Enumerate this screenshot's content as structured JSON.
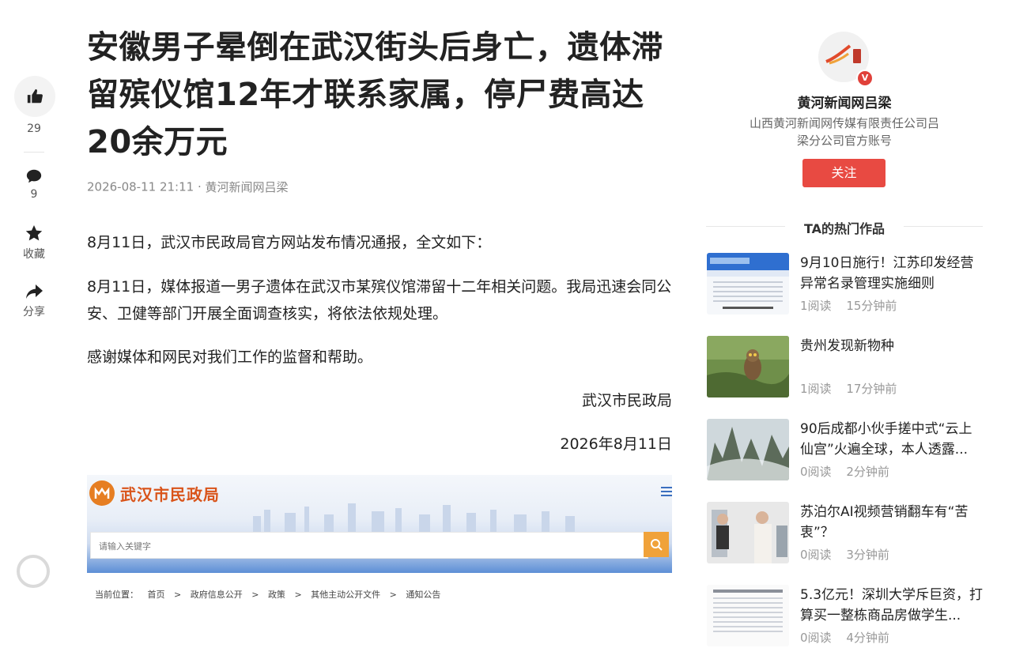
{
  "rail": {
    "like_count": "29",
    "comment_count": "9",
    "favorite_label": "收藏",
    "share_label": "分享"
  },
  "article": {
    "title": "安徽男子晕倒在武汉街头后身亡，遗体滞留殡仪馆12年才联系家属，停尸费高达20余万元",
    "datetime": "2026-08-11 21:11",
    "separator": "·",
    "source": "黄河新闻网吕梁",
    "paragraphs": [
      "8月11日，武汉市民政局官方网站发布情况通报，全文如下：",
      "8月11日，媒体报道一男子遗体在武汉市某殡仪馆滞留十二年相关问题。我局迅速会同公安、卫健等部门开展全面调查核实，将依法依规处理。",
      "感谢媒体和网民对我们工作的监督和帮助。"
    ],
    "signature": "武汉市民政局",
    "sign_date": "2026年8月11日"
  },
  "embedded_image": {
    "site_name": "武汉市民政局",
    "search_placeholder": "请输入关键字",
    "breadcrumb": [
      "当前位置：",
      "首页",
      ">",
      "政府信息公开",
      ">",
      "政策",
      ">",
      "其他主动公开文件",
      ">",
      "通知公告"
    ]
  },
  "sidebar": {
    "author_name": "黄河新闻网吕梁",
    "author_desc": "山西黄河新闻网传媒有限责任公司吕梁分公司官方账号",
    "verify_badge": "V",
    "follow_label": "关注",
    "hot_heading": "TA的热门作品",
    "hot_items": [
      {
        "title": "9月10日施行！江苏印发经营异常名录管理实施细则",
        "reads": "1阅读",
        "time": "15分钟前"
      },
      {
        "title": "贵州发现新物种",
        "reads": "1阅读",
        "time": "17分钟前"
      },
      {
        "title": "90后成都小伙手搓中式“云上仙宫”火遍全球，本人透露...",
        "reads": "0阅读",
        "time": "2分钟前"
      },
      {
        "title": "苏泊尔AI视频营销翻车有“苦衷”？",
        "reads": "0阅读",
        "time": "3分钟前"
      },
      {
        "title": "5.3亿元！深圳大学斥巨资，打算买一整栋商品房做学生...",
        "reads": "0阅读",
        "time": "4分钟前"
      }
    ]
  },
  "colors": {
    "follow_red": "#e84a42",
    "accent_orange": "#d9541a",
    "search_orange": "#f0a23a"
  }
}
